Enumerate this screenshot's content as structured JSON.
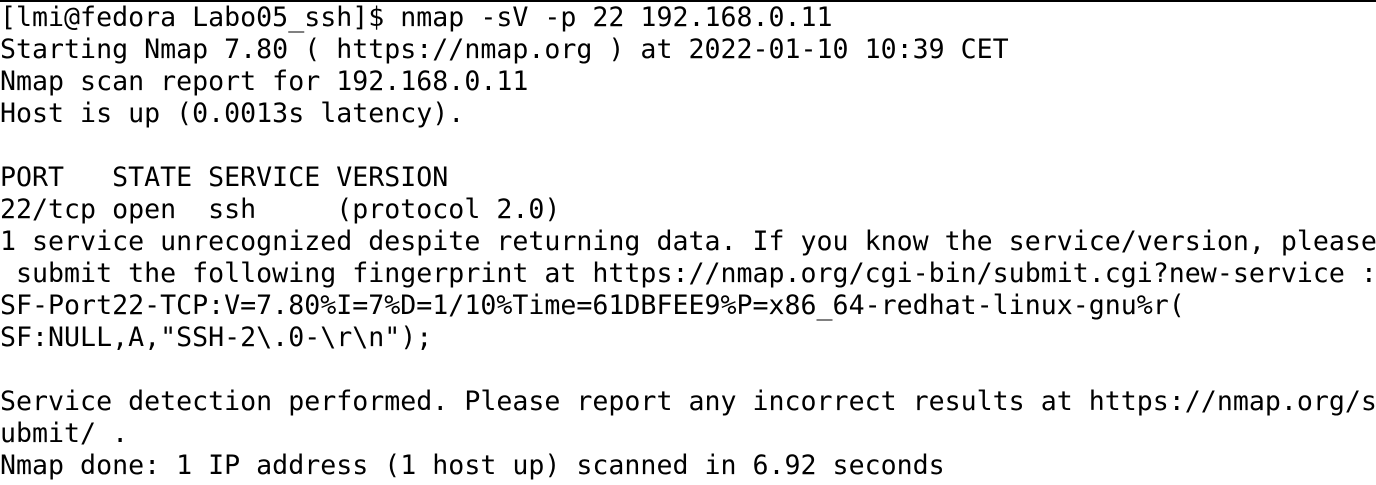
{
  "terminal": {
    "lines": [
      "[lmi@fedora Labo05_ssh]$ nmap -sV -p 22 192.168.0.11",
      "Starting Nmap 7.80 ( https://nmap.org ) at 2022-01-10 10:39 CET",
      "Nmap scan report for 192.168.0.11",
      "Host is up (0.0013s latency).",
      "",
      "PORT   STATE SERVICE VERSION",
      "22/tcp open  ssh     (protocol 2.0)",
      "1 service unrecognized despite returning data. If you know the service/version, please",
      " submit the following fingerprint at https://nmap.org/cgi-bin/submit.cgi?new-service :",
      "SF-Port22-TCP:V=7.80%I=7%D=1/10%Time=61DBFEE9%P=x86_64-redhat-linux-gnu%r(",
      "SF:NULL,A,\"SSH-2\\.0-\\r\\n\");",
      "",
      "Service detection performed. Please report any incorrect results at https://nmap.org/s",
      "ubmit/ .",
      "Nmap done: 1 IP address (1 host up) scanned in 6.92 seconds"
    ]
  }
}
